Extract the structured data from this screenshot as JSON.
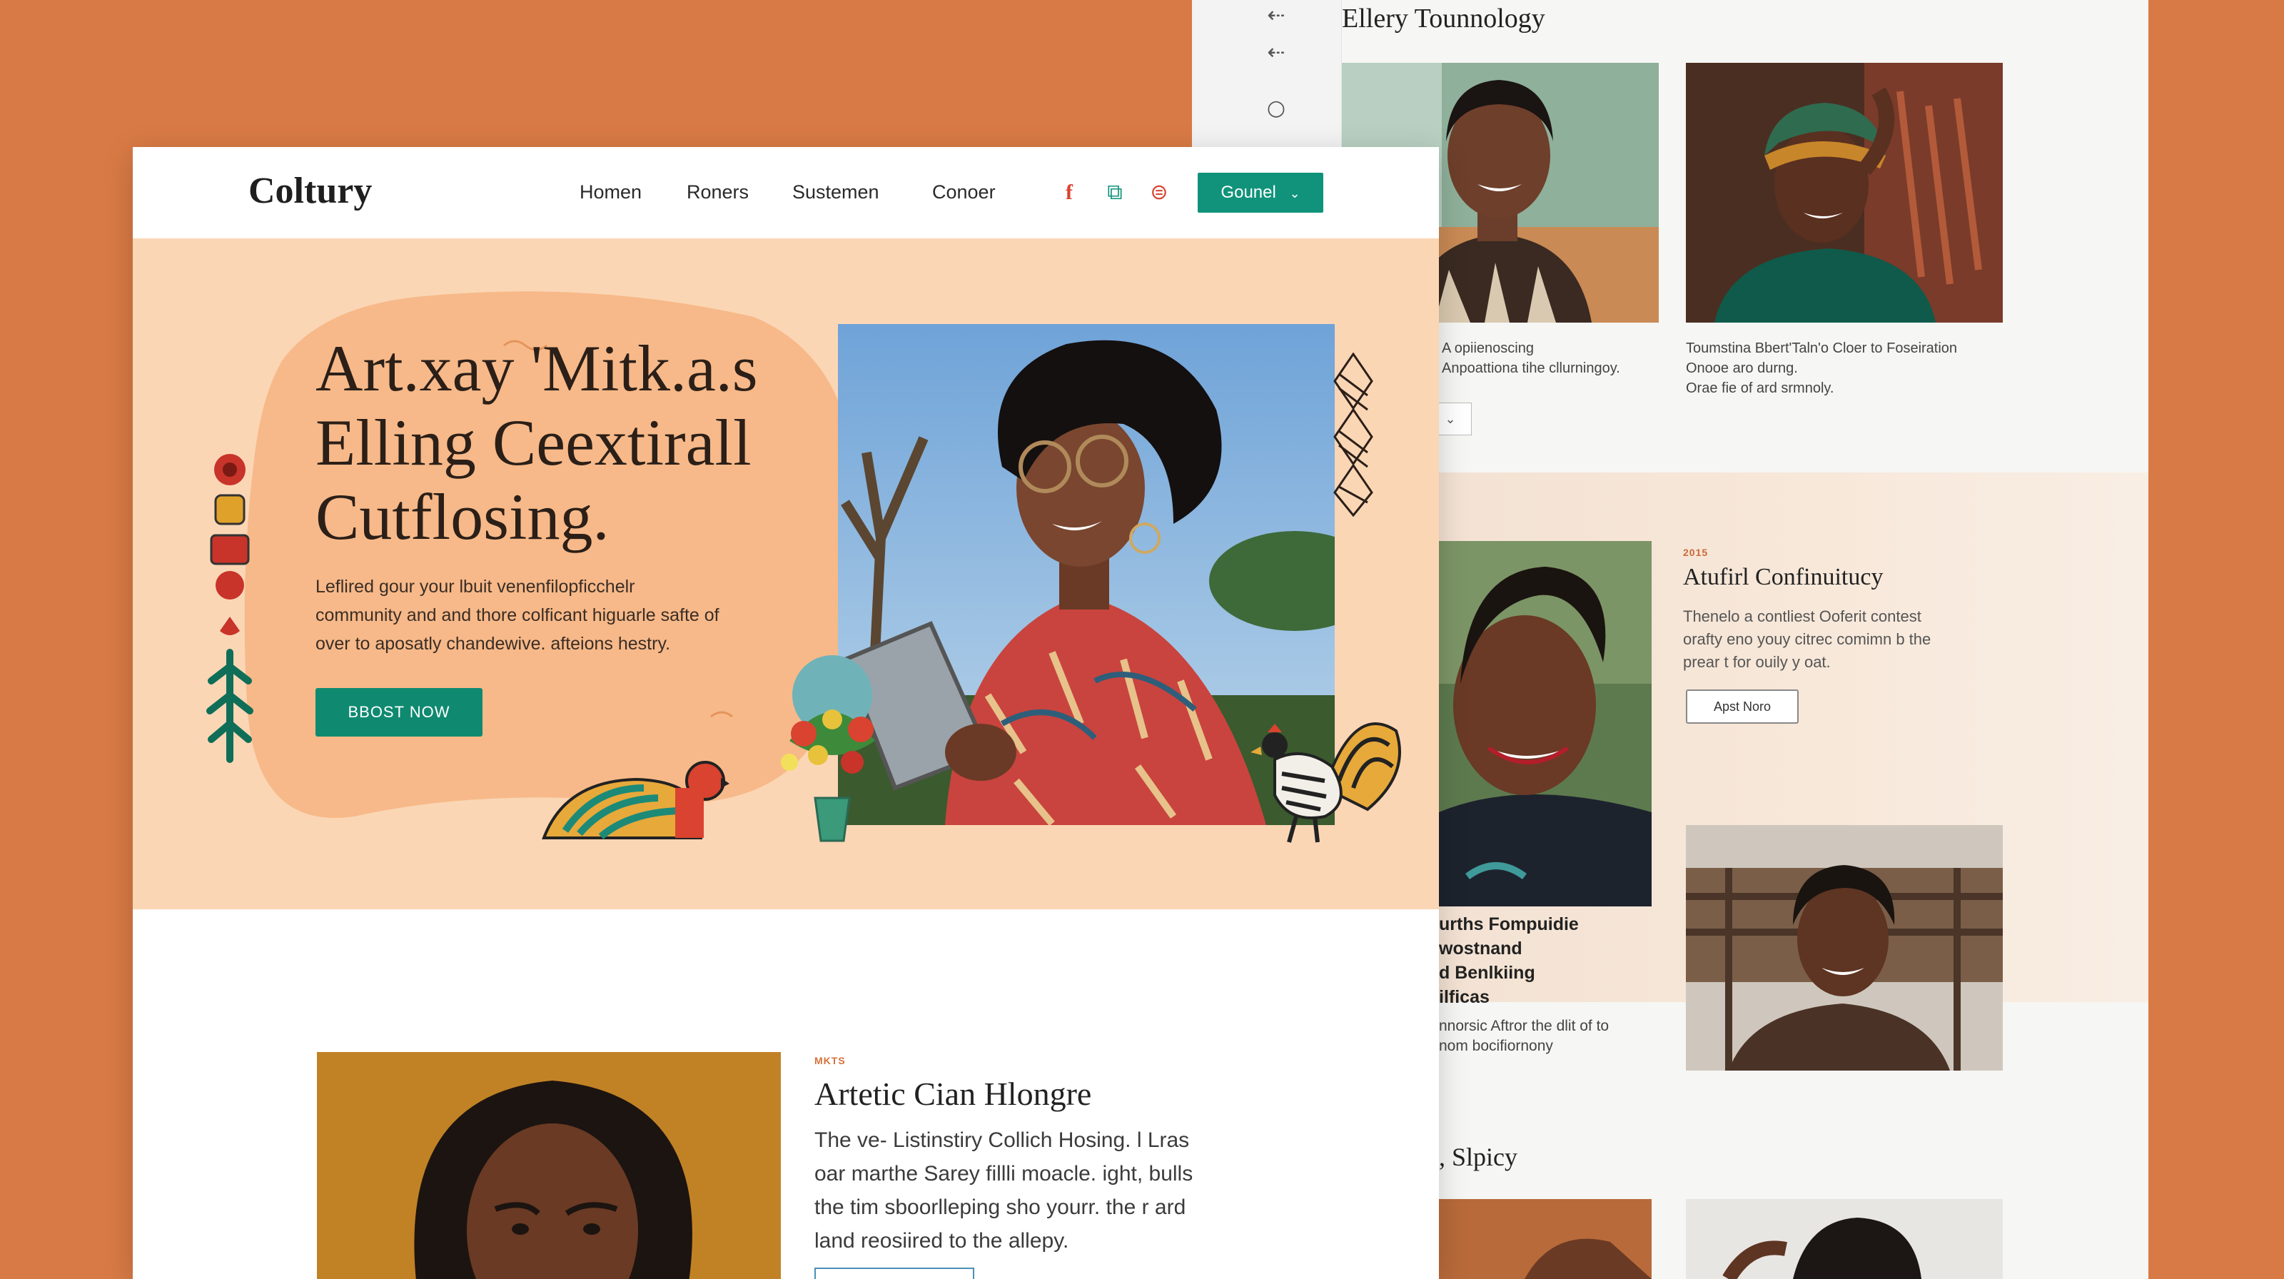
{
  "back_panel": {
    "title": "Ellery Tounnology",
    "rail_icons": [
      "arrow-left-icon",
      "arrow-left-icon",
      "circle-icon"
    ],
    "card1_caption": [
      "A opiienoscing",
      "Anpoattiona tihe cllurningoy."
    ],
    "card2_caption": [
      "Toumstina Bbert'Taln'o Cloer to Foseiration",
      "Onooe aro durng.",
      "Orae fie of ard srmnoly."
    ],
    "select_value": "⌄",
    "feature": {
      "eyebrow": "2015",
      "title": "Atufirl Confinuitucy",
      "body": [
        "Thenelo a contliest Ooferit contest",
        "orafty eno youy citrec comimn b the",
        "prear t for ouily y oat."
      ],
      "button": "Apst Noro"
    },
    "person_caption_bold": [
      "urths Fompuidie",
      "wostnand",
      "d Benlkiing",
      "ilficas"
    ],
    "person_caption": [
      "nnorsic Aftror the dlit of to",
      "nom bocifiornony"
    ],
    "section_label": ", Slpicy"
  },
  "front": {
    "logo": "Coltury",
    "nav": [
      "Homen",
      "Roners",
      "Sustemen",
      "Conoer"
    ],
    "social_icons": [
      "facebook-icon",
      "share-icon",
      "pinterest-icon"
    ],
    "cta": "Gounel",
    "hero": {
      "heading": [
        "Art.xay 'Mitk.a.s",
        "Elling Ceextirall",
        "Cutflosing."
      ],
      "paragraph": [
        "Leflired gour your lbuit venenfilopficchelr",
        "community and and thore colficant higuarle safte of",
        "over to aposatly chandewive. afteions hestry."
      ],
      "button": "BBOST NOW"
    },
    "article": {
      "eyebrow": "MKTS",
      "title": "Artetic Cian Hlongre",
      "body": [
        "The ve- Listinstiry Collich Hosing. l Lras",
        "oar marthe Sarey fillli moacle. ight, bulls",
        "the tim sboorlleping sho yourr. the r ard",
        "land reosiired to the allepy."
      ]
    }
  },
  "colors": {
    "background": "#d87a45",
    "hero": "#fbd6b5",
    "accent_green": "#10937a",
    "title": "#2b1f18"
  }
}
